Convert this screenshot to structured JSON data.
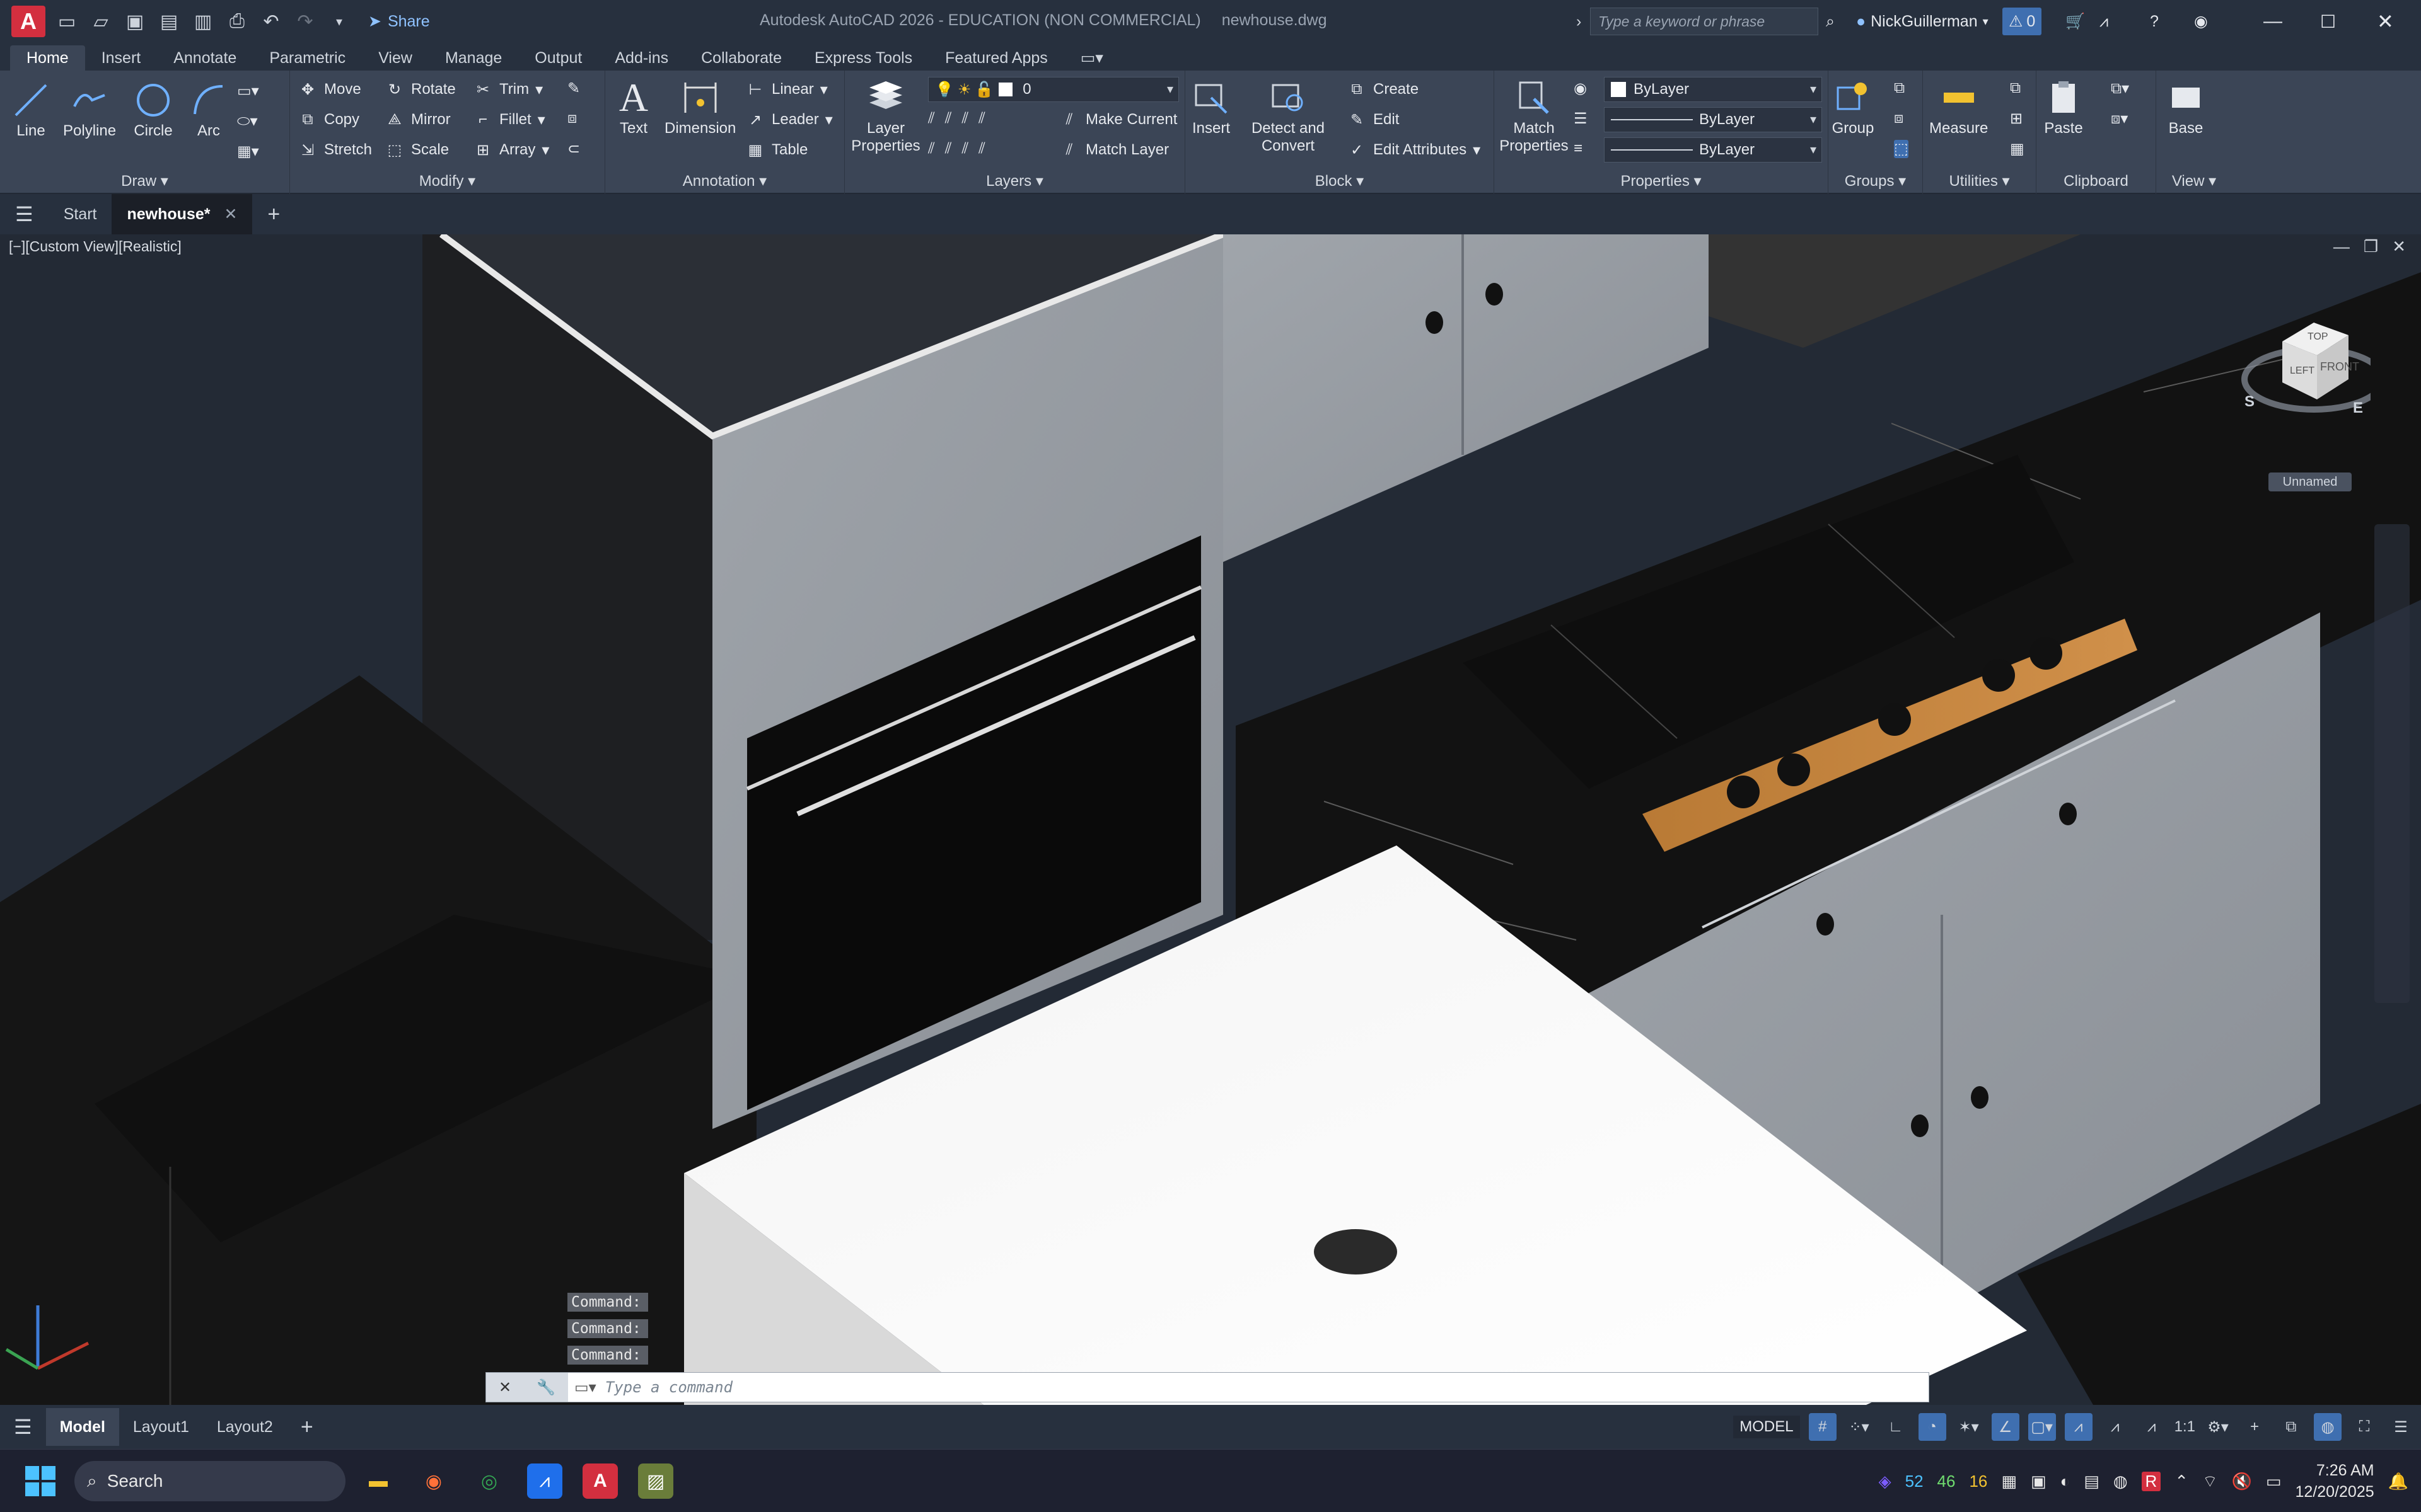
{
  "titlebar": {
    "app_logo": "A",
    "share_label": "Share",
    "app_title": "Autodesk AutoCAD 2026 - EDUCATION (NON COMMERCIAL)",
    "file_name": "newhouse.dwg",
    "search_placeholder": "Type a keyword or phrase",
    "user_name": "NickGuillerman",
    "alert_count": "0"
  },
  "ribbon_tabs": [
    "Home",
    "Insert",
    "Annotate",
    "Parametric",
    "View",
    "Manage",
    "Output",
    "Add-ins",
    "Collaborate",
    "Express Tools",
    "Featured Apps"
  ],
  "ribbon": {
    "draw": {
      "title": "Draw",
      "line": "Line",
      "polyline": "Polyline",
      "circle": "Circle",
      "arc": "Arc"
    },
    "modify": {
      "title": "Modify",
      "move": "Move",
      "rotate": "Rotate",
      "trim": "Trim",
      "copy": "Copy",
      "mirror": "Mirror",
      "fillet": "Fillet",
      "stretch": "Stretch",
      "scale": "Scale",
      "array": "Array"
    },
    "annotation": {
      "title": "Annotation",
      "text": "Text",
      "dimension": "Dimension",
      "linear": "Linear",
      "leader": "Leader",
      "table": "Table"
    },
    "layers": {
      "title": "Layers",
      "layer_properties": "Layer Properties",
      "current_layer": "0",
      "make_current": "Make Current",
      "match_layer": "Match Layer"
    },
    "block": {
      "title": "Block",
      "insert": "Insert",
      "detect_convert": "Detect and Convert",
      "create": "Create",
      "edit": "Edit",
      "edit_attributes": "Edit Attributes"
    },
    "properties": {
      "title": "Properties",
      "match_properties": "Match Properties",
      "color": "ByLayer",
      "linetype": "ByLayer",
      "lineweight": "ByLayer"
    },
    "groups": {
      "title": "Groups",
      "group": "Group"
    },
    "utilities": {
      "title": "Utilities",
      "measure": "Measure"
    },
    "clipboard": {
      "title": "Clipboard",
      "paste": "Paste"
    },
    "view": {
      "title": "View",
      "base": "Base"
    }
  },
  "doc_tabs": {
    "start": "Start",
    "current": "newhouse*"
  },
  "viewport": {
    "label": "[−][Custom View][Realistic]",
    "viewcube": {
      "top": "TOP",
      "left": "LEFT",
      "front": "FRONT",
      "south": "S",
      "east": "E"
    },
    "ucs_name": "Unnamed"
  },
  "command": {
    "history": [
      "Command:",
      "Command:",
      "Command:"
    ],
    "placeholder": "Type a command"
  },
  "layout_tabs": [
    "Model",
    "Layout1",
    "Layout2"
  ],
  "status": {
    "model": "MODEL",
    "scale": "1:1"
  },
  "taskbar": {
    "search_label": "Search",
    "tray_numbers": [
      "52",
      "46",
      "16"
    ],
    "time": "7:26 AM",
    "date": "12/20/2025"
  },
  "colors": {
    "accent": "#3f6fb0",
    "brand": "#d32f3f",
    "countertop": "#121212",
    "cabinet": "#9a9fa6"
  }
}
